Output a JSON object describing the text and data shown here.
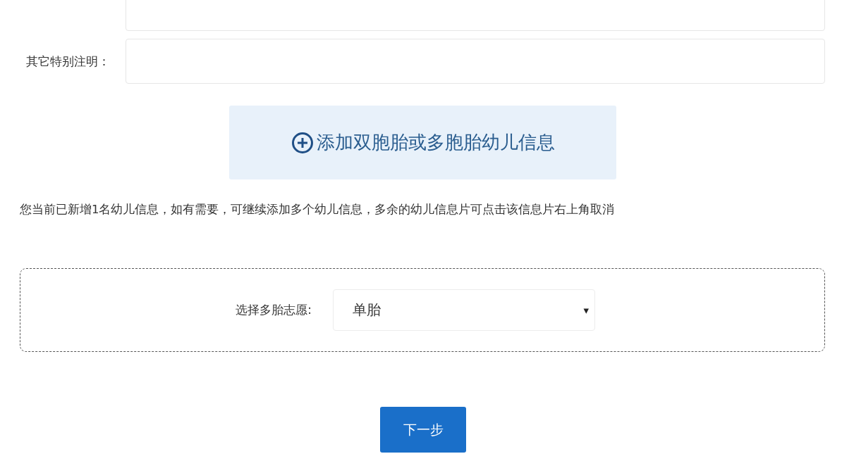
{
  "fields": [
    {
      "kind": "partial"
    },
    {
      "kind": "text",
      "label": "其它特别注明："
    }
  ],
  "add_button": {
    "label": "添加双胞胎或多胞胎幼儿信息"
  },
  "notice": "您当前已新增1名幼儿信息，如有需要，可继续添加多个幼儿信息，多余的幼儿信息片可点击该信息片右上角取消",
  "multi_birth": {
    "label": "选择多胎志愿:",
    "value": "单胎",
    "caret": "▾"
  },
  "next_button": {
    "label": "下一步"
  }
}
